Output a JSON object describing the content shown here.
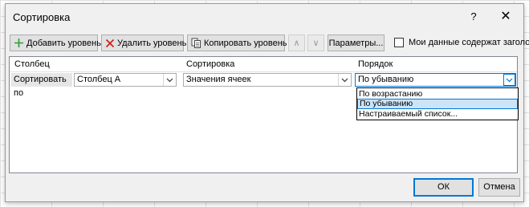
{
  "dialog": {
    "title": "Сортировка",
    "help_label": "?",
    "close_label": "✕"
  },
  "toolbar": {
    "add_level": "Добавить уровень",
    "delete_level": "Удалить уровень",
    "copy_level": "Копировать уровень",
    "move_up": "∧",
    "move_down": "∨",
    "options": "Параметры...",
    "headers_checkbox_label": "Мои данные содержат заголовки",
    "headers_checkbox_checked": false
  },
  "grid": {
    "headers": {
      "column": "Столбец",
      "sort_on": "Сортировка",
      "order": "Порядок"
    },
    "row": {
      "label": "Сортировать по",
      "column_value": "Столбец A",
      "sort_on_value": "Значения ячеек",
      "order_value": "По убыванию"
    }
  },
  "order_dropdown": {
    "options": [
      "По возрастанию",
      "По убыванию",
      "Настраиваемый список..."
    ],
    "selected": "По убыванию"
  },
  "footer": {
    "ok": "ОК",
    "cancel": "Отмена"
  },
  "colors": {
    "accent": "#0078d7",
    "selection": "#cce4f7",
    "dialog_bg": "#f0f0f0",
    "delete_icon": "#d11a1a",
    "add_icon": "#2e9c3a"
  }
}
